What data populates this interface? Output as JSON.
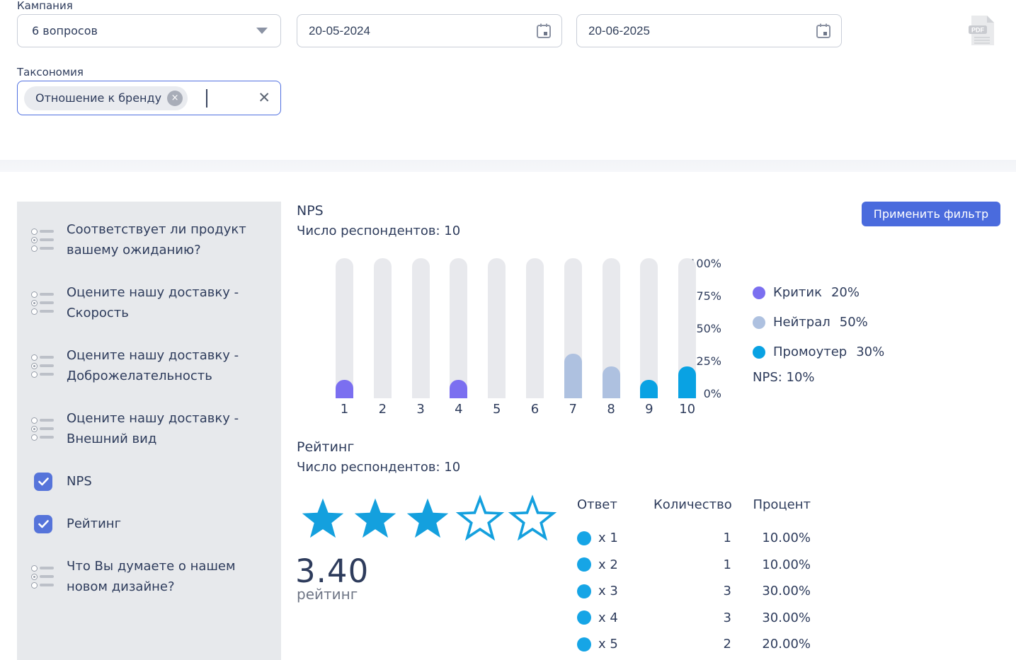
{
  "filters": {
    "campaign_label": "Кампания",
    "campaign_value": "6 вопросов",
    "date_from": "20-05-2024",
    "date_to": "20-06-2025",
    "taxonomy_label": "Таксономия",
    "taxonomy_chip": "Отношение к бренду",
    "chip_remove_icon": "×",
    "clear_icon": "✕",
    "export_icon_label": "PDF"
  },
  "apply_button_label": "Применить фильтр",
  "sidebar": {
    "items": [
      {
        "label": "Соответствует ли продукт вашему ожиданию?",
        "type": "list"
      },
      {
        "label": "Оцените нашу доставку - Скорость",
        "type": "list"
      },
      {
        "label": "Оцените нашу доставку - Доброжелательность",
        "type": "list"
      },
      {
        "label": "Оцените нашу доставку - Внешний вид",
        "type": "list"
      },
      {
        "label": "NPS",
        "type": "checkbox",
        "checked": true
      },
      {
        "label": "Рейтинг",
        "type": "checkbox",
        "checked": true
      },
      {
        "label": "Что Вы думаете о нашем новом дизайне?",
        "type": "list"
      }
    ]
  },
  "colors": {
    "accent_blue": "#4a6bdd",
    "checkbox_blue": "#5674da",
    "critic_purple": "#7b6ff0",
    "neutral_blue": "#aec1e0",
    "promoter_cyan": "#09a2e3",
    "star_cyan": "#14a0de",
    "track_gray": "#e8e9ed",
    "sidebar_gray": "#e7e9ec",
    "text_navy": "#2e3c5c"
  },
  "chart_data": [
    {
      "type": "bar",
      "title": "NPS",
      "respondents_label": "Число респондентов: 10",
      "categories": [
        "1",
        "2",
        "3",
        "4",
        "5",
        "6",
        "7",
        "8",
        "9",
        "10"
      ],
      "values": [
        10,
        0,
        0,
        10,
        0,
        0,
        30,
        20,
        10,
        20
      ],
      "bar_colors": [
        "#7b6ff0",
        null,
        null,
        "#7b6ff0",
        null,
        null,
        "#aec1e0",
        "#aec1e0",
        "#09a2e3",
        "#09a2e3"
      ],
      "ylim": [
        0,
        100
      ],
      "yticks": [
        "100%",
        "75%",
        "50%",
        "25%",
        "0%"
      ],
      "grid": false,
      "legend_position": "right",
      "legend": [
        {
          "label": "Критик",
          "value": "20%",
          "color": "#7b6ff0"
        },
        {
          "label": "Нейтрал",
          "value": "50%",
          "color": "#aec1e0"
        },
        {
          "label": "Промоутер",
          "value": "30%",
          "color": "#09a2e3"
        }
      ],
      "footer": "NPS: 10%"
    },
    {
      "type": "table",
      "title": "Рейтинг",
      "respondents_label": "Число респондентов: 10",
      "rating_value": "3.40",
      "rating_caption": "рейтинг",
      "stars_filled": 3,
      "stars_total": 5,
      "columns": [
        "Ответ",
        "Количество",
        "Процент"
      ],
      "rows": [
        {
          "answer": "x 1",
          "count": "1",
          "percent": "10.00%"
        },
        {
          "answer": "x 2",
          "count": "1",
          "percent": "10.00%"
        },
        {
          "answer": "x 3",
          "count": "3",
          "percent": "30.00%"
        },
        {
          "answer": "x 4",
          "count": "3",
          "percent": "30.00%"
        },
        {
          "answer": "x 5",
          "count": "2",
          "percent": "20.00%"
        }
      ]
    }
  ]
}
